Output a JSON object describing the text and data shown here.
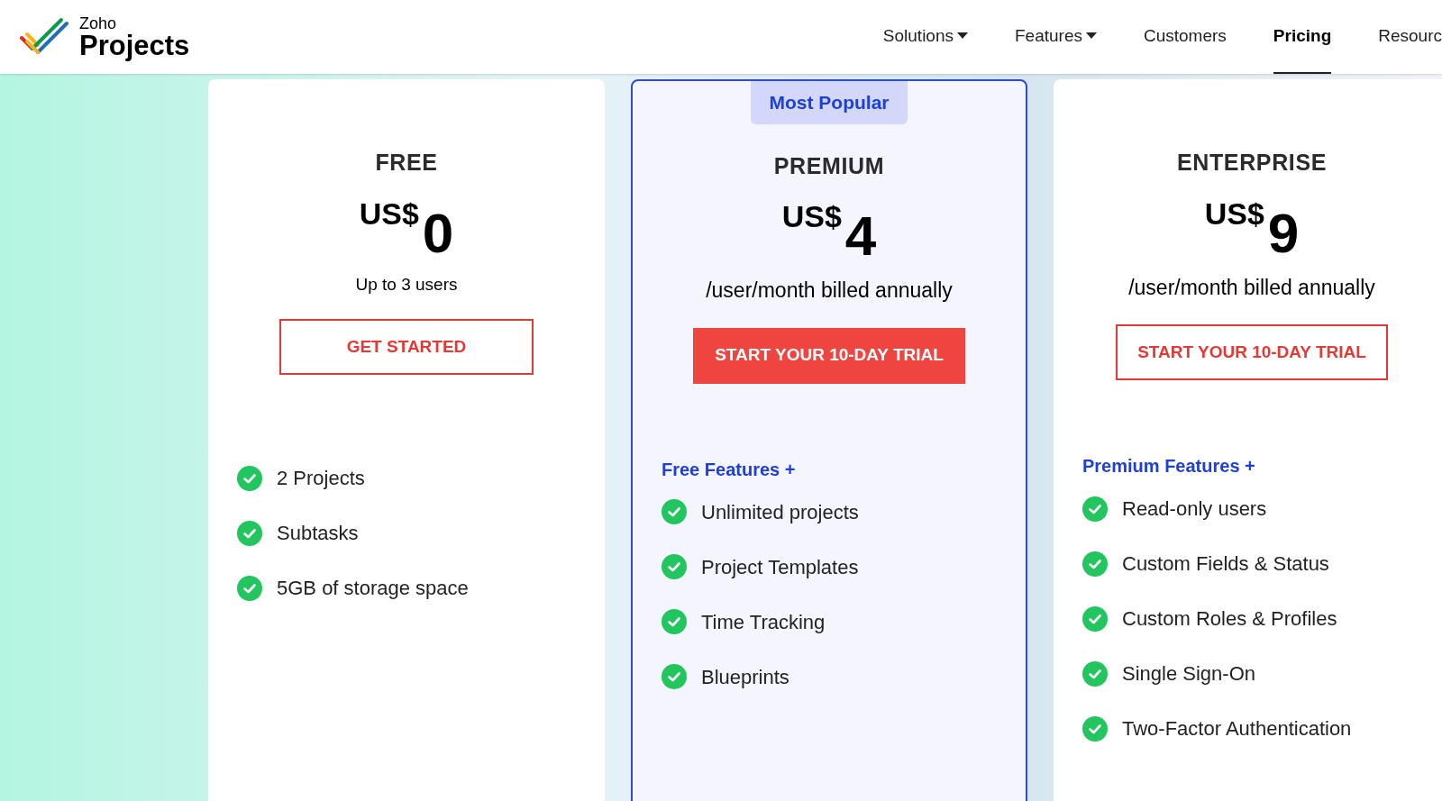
{
  "header": {
    "logo": {
      "brand": "Zoho",
      "product": "Projects"
    },
    "nav": [
      {
        "label": "Solutions",
        "dropdown": true,
        "selected": false
      },
      {
        "label": "Features",
        "dropdown": true,
        "selected": false
      },
      {
        "label": "Customers",
        "dropdown": false,
        "selected": false
      },
      {
        "label": "Pricing",
        "dropdown": false,
        "selected": true
      },
      {
        "label": "Resourc",
        "dropdown": false,
        "selected": false
      }
    ]
  },
  "plans": [
    {
      "name": "FREE",
      "featured": false,
      "currency": "US$",
      "price": "0",
      "period": "Up to 3 users",
      "button": "GET STARTED",
      "features": [
        "2 Projects",
        "Subtasks",
        "5GB of storage space"
      ]
    },
    {
      "name": "PREMIUM",
      "featured": true,
      "badge": "Most Popular",
      "currency": "US$",
      "price": "4",
      "period": "/user/month billed annually",
      "button": "START YOUR 10-DAY TRIAL",
      "features_heading": "Free Features +",
      "features": [
        "Unlimited projects",
        "Project Templates",
        "Time Tracking",
        "Blueprints"
      ]
    },
    {
      "name": "ENTERPRISE",
      "featured": false,
      "currency": "US$",
      "price": "9",
      "period": "/user/month billed annually",
      "button": "START YOUR 10-DAY TRIAL",
      "features_heading": "Premium Features +",
      "features": [
        "Read-only users",
        "Custom Fields & Status",
        "Custom Roles & Profiles",
        "Single Sign-On",
        "Two-Factor Authentication"
      ]
    }
  ]
}
